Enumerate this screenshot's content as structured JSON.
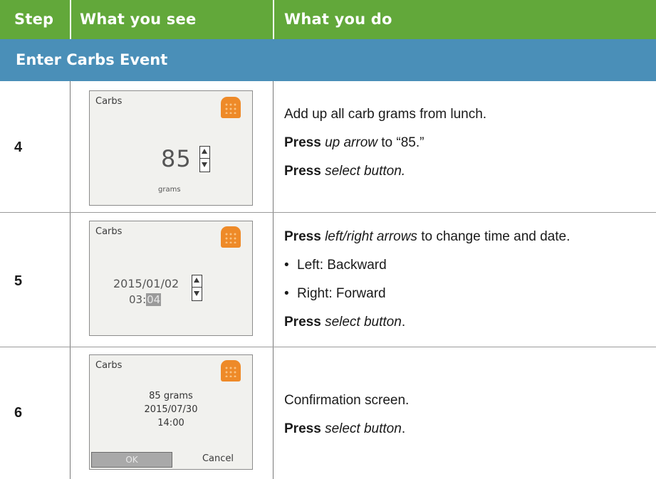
{
  "header": {
    "step": "Step",
    "what_you_see": "What you see",
    "what_you_do": "What you do"
  },
  "section": {
    "title": "Enter Carbs Event"
  },
  "colors": {
    "header_bg": "#62a83a",
    "section_bg": "#4a8fb8",
    "icon_orange": "#ee8a28"
  },
  "rows": [
    {
      "step": "4",
      "screen": {
        "title": "Carbs",
        "icon": "bread-icon",
        "value": "85",
        "unit": "grams"
      },
      "do": {
        "line1": "Add up all carb grams from lunch.",
        "line2_bold": "Press",
        "line2_italic": "up arrow",
        "line2_rest": " to “85.”",
        "line3_bold": "Press",
        "line3_italic": "select button."
      }
    },
    {
      "step": "5",
      "screen": {
        "title": "Carbs",
        "icon": "bread-icon",
        "date": "2015/01/02",
        "time_hour": "03:",
        "time_min": "04"
      },
      "do": {
        "line1_bold": "Press",
        "line1_italic": "left/right arrows",
        "line1_rest": " to change time and date.",
        "bullet1": "Left: Backward",
        "bullet2": "Right: Forward",
        "line4_bold": "Press",
        "line4_italic": "select button",
        "line4_rest": "."
      }
    },
    {
      "step": "6",
      "screen": {
        "title": "Carbs",
        "icon": "bread-icon",
        "amount": "85 grams",
        "date": "2015/07/30",
        "time": "14:00",
        "ok": "OK",
        "cancel": "Cancel"
      },
      "do": {
        "line1": "Confirmation screen.",
        "line2_bold": "Press",
        "line2_italic": "select button",
        "line2_rest": "."
      }
    }
  ]
}
